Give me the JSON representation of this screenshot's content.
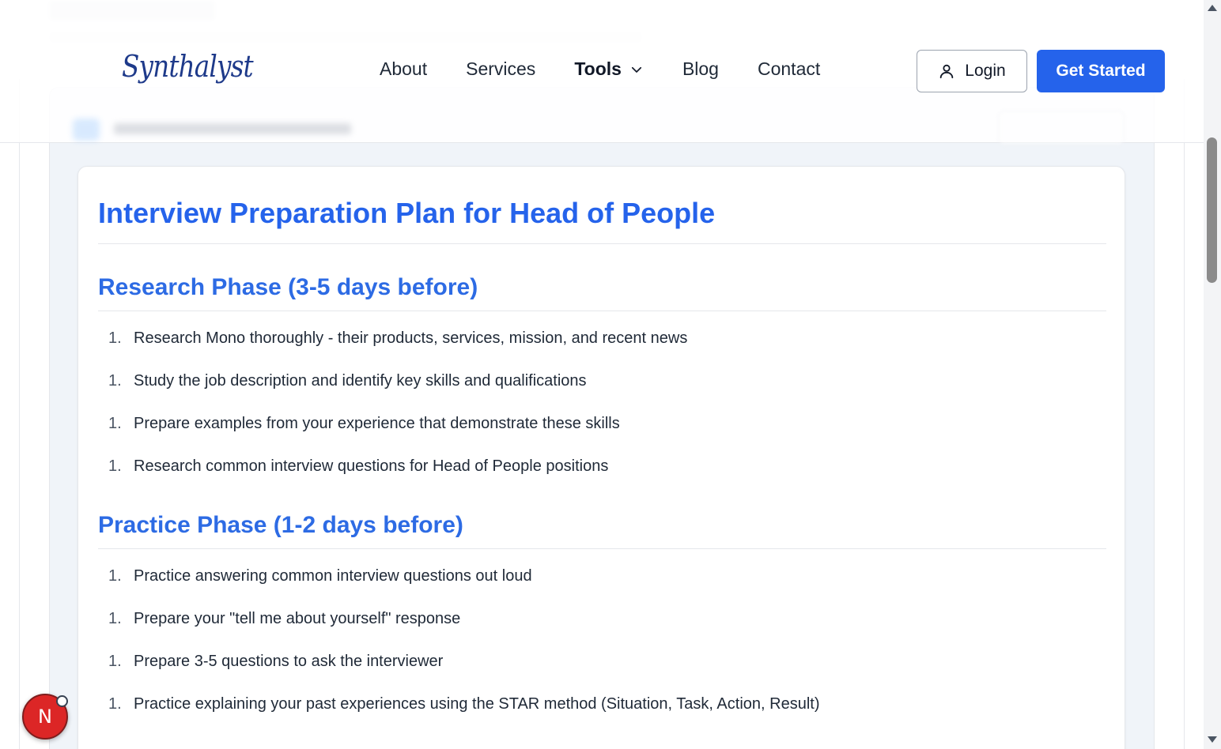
{
  "header": {
    "logo": "Synthalyst",
    "nav": [
      {
        "label": "About"
      },
      {
        "label": "Services"
      },
      {
        "label": "Tools"
      },
      {
        "label": "Blog"
      },
      {
        "label": "Contact"
      }
    ],
    "login_label": "Login",
    "cta_label": "Get Started"
  },
  "document": {
    "title": "Interview Preparation Plan for Head of People",
    "sections": [
      {
        "heading": "Research Phase (3-5 days before)",
        "items": [
          {
            "num": "1.",
            "text": "Research Mono thoroughly - their products, services, mission, and recent news"
          },
          {
            "num": "1.",
            "text": "Study the job description and identify key skills and qualifications"
          },
          {
            "num": "1.",
            "text": "Prepare examples from your experience that demonstrate these skills"
          },
          {
            "num": "1.",
            "text": "Research common interview questions for Head of People positions"
          }
        ]
      },
      {
        "heading": "Practice Phase (1-2 days before)",
        "items": [
          {
            "num": "1.",
            "text": "Practice answering common interview questions out loud"
          },
          {
            "num": "1.",
            "text": "Prepare your \"tell me about yourself\" response"
          },
          {
            "num": "1.",
            "text": "Prepare 3-5 questions to ask the interviewer"
          },
          {
            "num": "1.",
            "text": "Practice explaining your past experiences using the STAR method (Situation, Task, Action, Result)"
          }
        ]
      }
    ]
  },
  "floating_badge": {
    "letter": "N"
  },
  "colors": {
    "accent": "#2563eb",
    "heading": "#2d6be4",
    "badge": "#dc2626"
  }
}
